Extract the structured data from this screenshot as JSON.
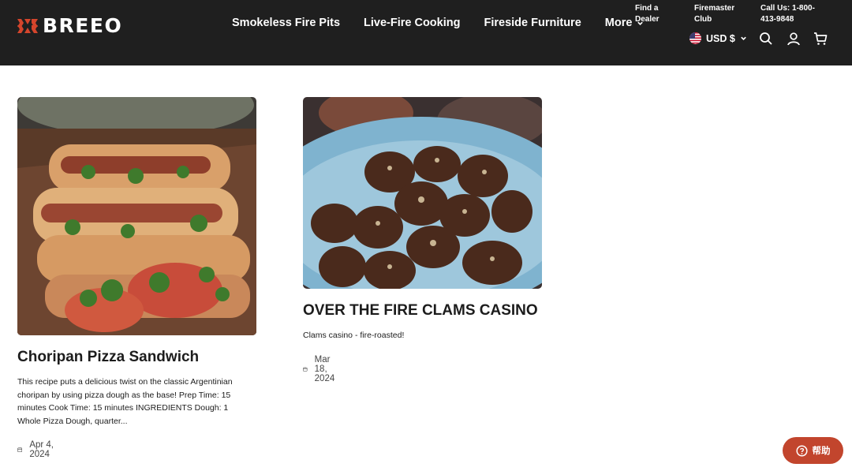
{
  "brand": {
    "name": "BREEO"
  },
  "nav": {
    "items": [
      {
        "label": "Smokeless Fire Pits"
      },
      {
        "label": "Live-Fire Cooking"
      },
      {
        "label": "Fireside Furniture"
      },
      {
        "label": "More"
      }
    ]
  },
  "utility": {
    "find_dealer": "Find a Dealer",
    "firemaster_club": "Firemaster Club",
    "call_us": "Call Us: 1-800-413-9848",
    "currency": "USD $"
  },
  "articles": [
    {
      "title": "Choripan Pizza Sandwich",
      "excerpt": "This recipe puts a delicious twist on the classic Argentinian choripan by using pizza dough as the base! Prep Time: 15 minutes Cook Time: 15 minutes INGREDIENTS Dough: 1 Whole Pizza Dough, quarter...",
      "date": "Apr 4, 2024"
    },
    {
      "title": "OVER THE FIRE CLAMS CASINO",
      "excerpt": "Clams casino - fire-roasted!",
      "date": "Mar 18, 2024"
    }
  ],
  "help": {
    "label": "帮助"
  },
  "colors": {
    "header_bg": "#1f1f1f",
    "brand_red": "#c2452d",
    "plate_blue": "#7fb3cf"
  },
  "icons": [
    "breeo-logo-icon",
    "chevron-down-icon",
    "us-flag-icon",
    "search-icon",
    "account-icon",
    "cart-icon",
    "calendar-icon",
    "help-question-icon"
  ]
}
